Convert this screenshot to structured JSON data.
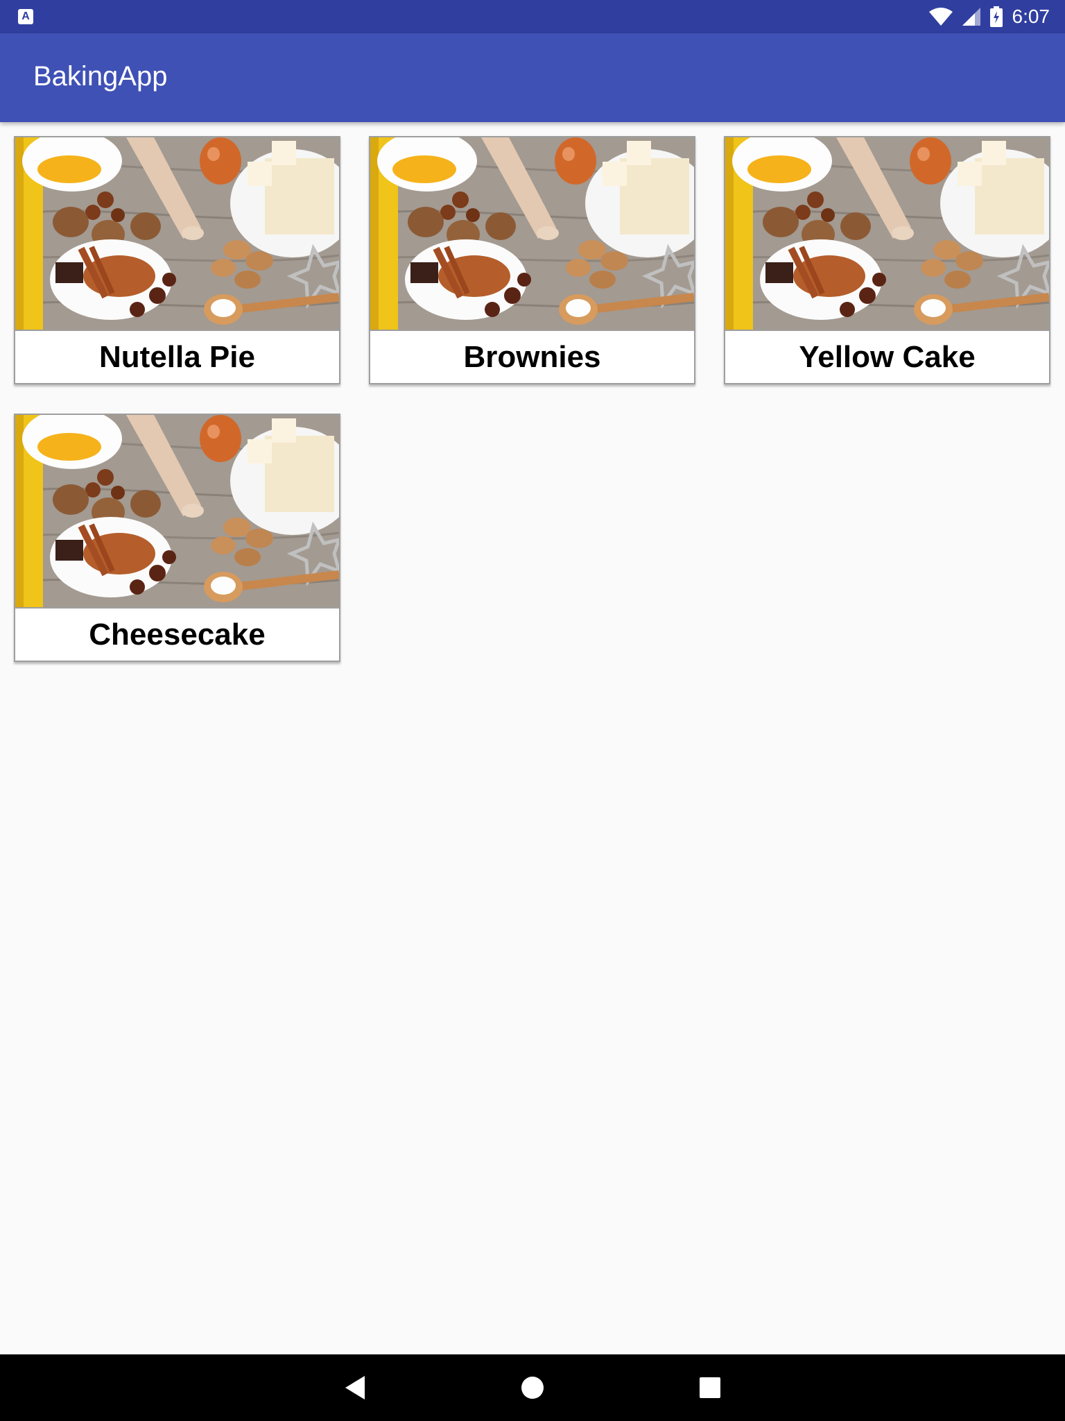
{
  "status_bar": {
    "notification_icon": "A",
    "time": "6:07",
    "icons": [
      "wifi-icon",
      "signal-icon",
      "battery-charging-icon"
    ]
  },
  "app_bar": {
    "title": "BakingApp"
  },
  "recipes": [
    {
      "name": "Nutella Pie",
      "image": "baking-ingredients-photo"
    },
    {
      "name": "Brownies",
      "image": "baking-ingredients-photo"
    },
    {
      "name": "Yellow Cake",
      "image": "baking-ingredients-photo"
    },
    {
      "name": "Cheesecake",
      "image": "baking-ingredients-photo"
    }
  ],
  "nav_bar": {
    "buttons": [
      "back-icon",
      "home-icon",
      "recents-icon"
    ]
  },
  "colors": {
    "status_bar": "#303f9f",
    "app_bar": "#3f51b5",
    "background": "#fafafa"
  }
}
